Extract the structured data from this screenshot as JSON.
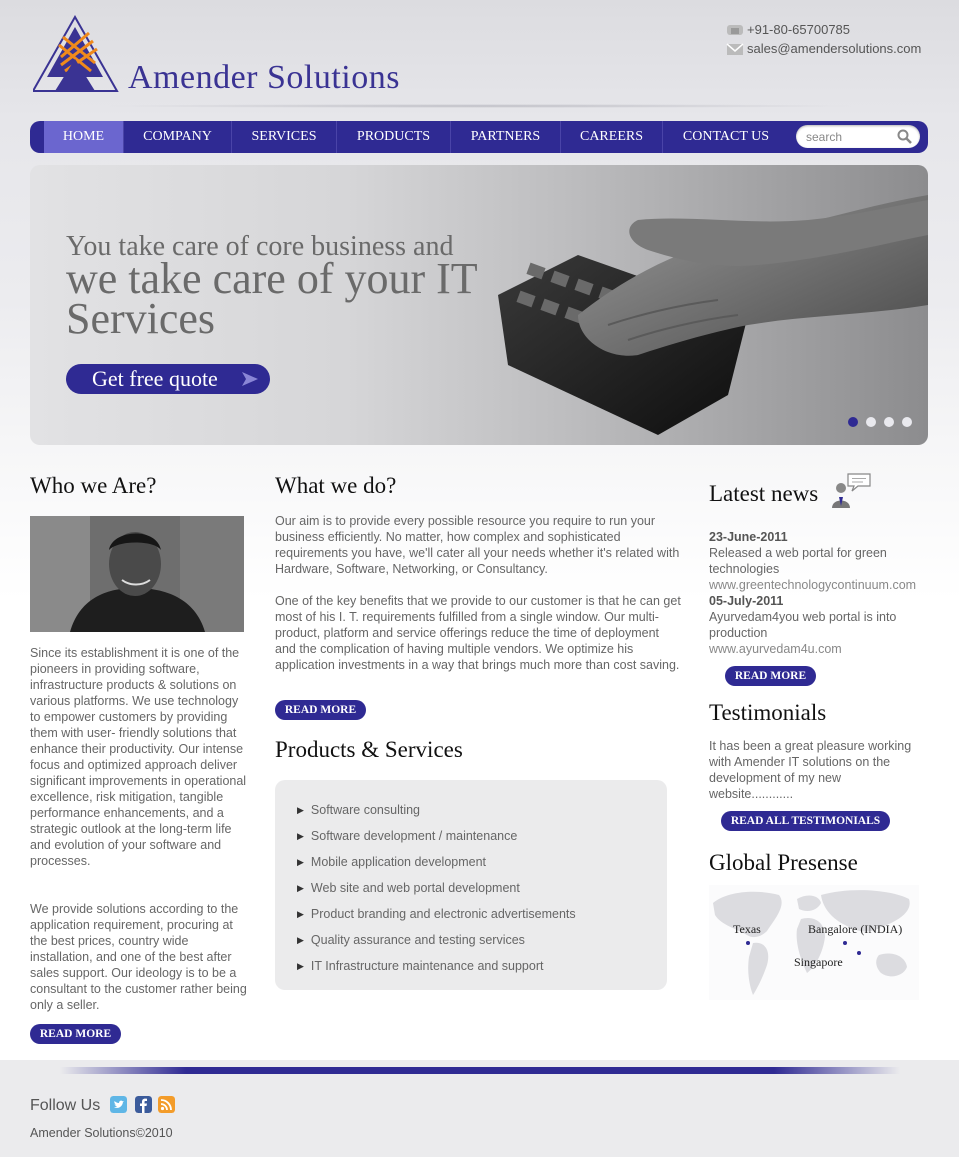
{
  "header": {
    "logo_text": "Amender Solutions",
    "phone": "+91-80-65700785",
    "email": "sales@amendersolutions.com"
  },
  "nav": {
    "items": [
      {
        "label": "HOME",
        "active": true
      },
      {
        "label": "COMPANY"
      },
      {
        "label": "SERVICES"
      },
      {
        "label": "PRODUCTS"
      },
      {
        "label": "PARTNERS"
      },
      {
        "label": "CAREERS"
      },
      {
        "label": "CONTACT US"
      }
    ],
    "search_placeholder": "search"
  },
  "hero": {
    "line1": "You take care of core business and",
    "line2": "we take care of your IT Services",
    "button": "Get free quote",
    "slides": 4,
    "active_slide": 1
  },
  "who": {
    "title": "Who we Are?",
    "para1": "Since its establishment it is one of the pioneers in providing software, infrastructure products & solutions on various platforms. We use technology to empower customers by providing them with user- friendly solutions that enhance their productivity. Our intense focus and optimized approach deliver significant improvements in operational excellence, risk mitigation, tangible performance enhancements, and a strategic outlook at the long-term life and evolution of your software and processes.",
    "para2": "We provide solutions according to the application requirement, procuring at the best prices, country wide installation, and one of the best after sales support. Our ideology is to be a consultant to the customer rather being only a seller.",
    "read_more": "READ MORE"
  },
  "what": {
    "title": "What we do?",
    "para1": "Our aim is to provide every possible resource you require to run your business efficiently. No matter, how complex and sophisticated requirements you have, we'll cater all your needs whether it's related with Hardware, Software, Networking, or Consultancy.",
    "para2": "One of the key benefits that we provide to our customer is that he can get most of his I. T. requirements fulfilled from a single window. Our multi-product, platform and service offerings reduce the time of deployment and the complication of having multiple vendors. We optimize his application investments in a way that brings much more than cost saving.",
    "read_more": "READ MORE"
  },
  "products": {
    "title": "Products & Services",
    "items": [
      "Software consulting",
      "Software development / maintenance",
      "Mobile application development",
      "Web site and web portal development",
      "Product branding and electronic advertisements",
      "Quality assurance and testing services",
      "IT Infrastructure maintenance and support"
    ]
  },
  "news": {
    "title": "Latest news",
    "items": [
      {
        "date": "23-June-2011",
        "text": "Released a web portal for green technologies",
        "link": "www.greentechnologycontinuum.com"
      },
      {
        "date": "05-July-2011",
        "text": "Ayurvedam4you web portal is into production",
        "link": "www.ayurvedam4u.com"
      }
    ],
    "read_more": "READ MORE"
  },
  "testimonials": {
    "title": "Testimonials",
    "text": "It has been a great pleasure working with Amender IT solutions on the development of my new website............",
    "button": "READ ALL TESTIMONIALS"
  },
  "global": {
    "title": "Global Presense",
    "locations": [
      "Texas",
      "Bangalore (INDIA)",
      "Singapore"
    ]
  },
  "footer": {
    "follow": "Follow Us",
    "copyright": "Amender Solutions©2010"
  },
  "colors": {
    "brand": "#2f2a93",
    "nav_active": "#6b66cf",
    "logo_orange": "#f08a1c"
  }
}
